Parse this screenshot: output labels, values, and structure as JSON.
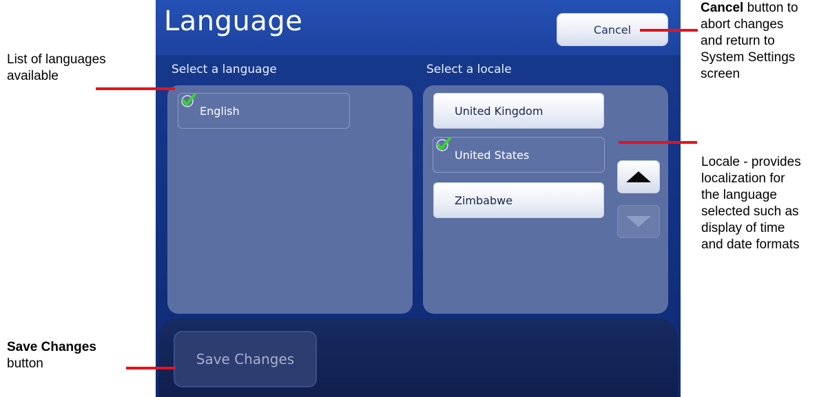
{
  "screen": {
    "title": "Language",
    "cancel_label": "Cancel",
    "language_section_label": "Select a language",
    "locale_section_label": "Select a locale",
    "languages": [
      {
        "label": "English",
        "selected": true
      }
    ],
    "locales": [
      {
        "label": "United Kingdom",
        "selected": false
      },
      {
        "label": "United States",
        "selected": true
      },
      {
        "label": "Zimbabwe",
        "selected": false
      }
    ],
    "scroll_up_icon": "triangle-up-icon",
    "scroll_down_icon": "triangle-down-icon",
    "scroll_down_enabled": false,
    "save_label": "Save Changes",
    "save_enabled": false,
    "colors": {
      "screen_bg": "#183a8e",
      "title_bar": "#2550b3",
      "panel": "#5c6fa3",
      "checkmark": "#3ad42b",
      "annotation_pointer": "#e8121c"
    }
  },
  "annotations": {
    "cancel": {
      "bold": "Cancel",
      "line1_rest": " button to",
      "line2": "abort changes",
      "line3": "and return to",
      "line4": "System Settings",
      "line5": "screen"
    },
    "languages": {
      "line1": "List of languages",
      "line2": "available"
    },
    "locale": {
      "line1": "Locale - provides",
      "line2": "localization for",
      "line3": "the language",
      "line4": "selected such as",
      "line5": "display of time",
      "line6": "and date formats"
    },
    "save": {
      "bold": "Save Changes",
      "line2": "button"
    }
  }
}
